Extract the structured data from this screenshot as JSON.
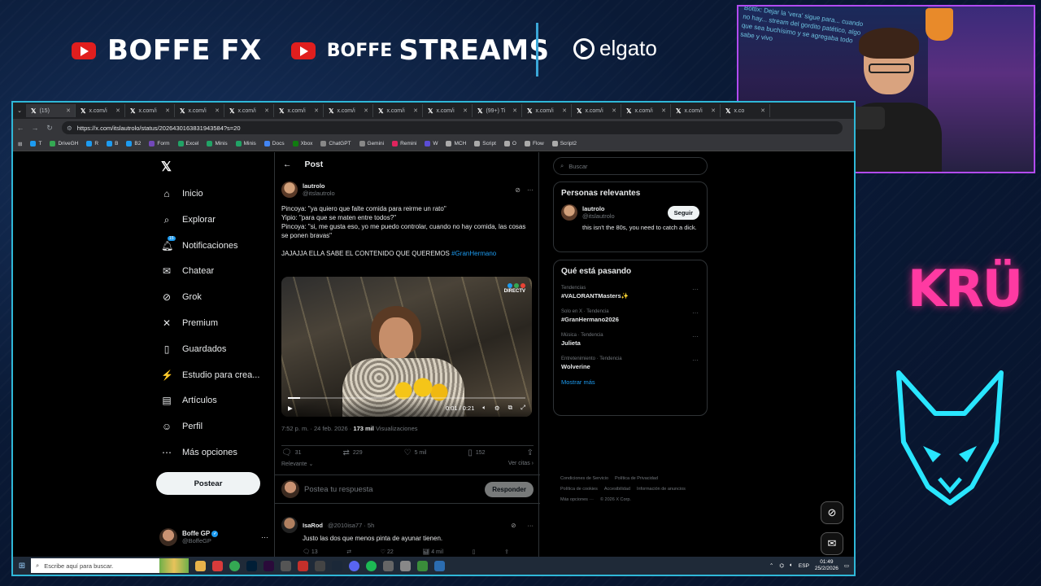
{
  "banner": {
    "brand1": "BOFFE FX",
    "brand2_small": "BOFFE",
    "brand2_big": "STREAMS",
    "sponsor": "elgato"
  },
  "overlay": {
    "kru": "KRÜ",
    "webcam_chat": "Bottix: Dejar la 'vera' sigue para... cuando no hay... stream del gordito patético, algo que sea buchísimo y se agregaba todo sabe y vivo"
  },
  "browser": {
    "tabs": [
      {
        "label": "(15)",
        "active": true
      },
      {
        "label": "x.com/i"
      },
      {
        "label": "x.com/i"
      },
      {
        "label": "x.com/i"
      },
      {
        "label": "x.com/i"
      },
      {
        "label": "x.com/i"
      },
      {
        "label": "x.com/i"
      },
      {
        "label": "x.com/i"
      },
      {
        "label": "x.com/i"
      },
      {
        "label": "(99+) Ti"
      },
      {
        "label": "x.com/i"
      },
      {
        "label": "x.com/i"
      },
      {
        "label": "x.com/i"
      },
      {
        "label": "x.com/i"
      },
      {
        "label": "x.co"
      }
    ],
    "url": "https://x.com/itslautrolo/status/2026430163831943584?s=20",
    "bookmarks": [
      {
        "label": "T",
        "color": "#1d9bf0"
      },
      {
        "label": "DriveGH",
        "color": "#34a853"
      },
      {
        "label": "R",
        "color": "#1d9bf0"
      },
      {
        "label": "B",
        "color": "#1d9bf0"
      },
      {
        "label": "B2",
        "color": "#1d9bf0"
      },
      {
        "label": "Form",
        "color": "#7248b9"
      },
      {
        "label": "Excel",
        "color": "#21a366"
      },
      {
        "label": "Minis",
        "color": "#21a366"
      },
      {
        "label": "Minis",
        "color": "#21a366"
      },
      {
        "label": "Docs",
        "color": "#4285f4"
      },
      {
        "label": "Xbox",
        "color": "#107c10"
      },
      {
        "label": "ChatGPT",
        "color": "#888888"
      },
      {
        "label": "Gemini",
        "color": "#888888"
      },
      {
        "label": "Remini",
        "color": "#e0245e"
      },
      {
        "label": "W",
        "color": "#5b4dd6"
      },
      {
        "label": "MCH",
        "color": "#aaaaaa"
      },
      {
        "label": "Script",
        "color": "#aaaaaa"
      },
      {
        "label": "O",
        "color": "#aaaaaa"
      },
      {
        "label": "Flow",
        "color": "#aaaaaa"
      },
      {
        "label": "Script2",
        "color": "#aaaaaa"
      }
    ]
  },
  "nav": {
    "items": [
      {
        "label": "Inicio",
        "icon": "home-icon",
        "glyph": "⌂"
      },
      {
        "label": "Explorar",
        "icon": "search-icon",
        "glyph": "⌕"
      },
      {
        "label": "Notificaciones",
        "icon": "bell-icon",
        "glyph": "🔔︎",
        "badge": "15"
      },
      {
        "label": "Chatear",
        "icon": "mail-icon",
        "glyph": "✉"
      },
      {
        "label": "Grok",
        "icon": "grok-icon",
        "glyph": "⊘"
      },
      {
        "label": "Premium",
        "icon": "x-premium-icon",
        "glyph": "✕"
      },
      {
        "label": "Guardados",
        "icon": "bookmark-icon",
        "glyph": "▯"
      },
      {
        "label": "Estudio para crea...",
        "icon": "studio-icon",
        "glyph": "⚡"
      },
      {
        "label": "Artículos",
        "icon": "articles-icon",
        "glyph": "▤"
      },
      {
        "label": "Perfil",
        "icon": "profile-icon",
        "glyph": "☺"
      },
      {
        "label": "Más opciones",
        "icon": "more-icon",
        "glyph": "⋯"
      }
    ],
    "post_button": "Postear",
    "account": {
      "name": "Boffe GP",
      "handle": "@BoffeGP"
    }
  },
  "post": {
    "header": "Post",
    "author_name": "lautrolo",
    "author_handle": "@itslautrolo",
    "lines": [
      "Pincoya: \"ya quiero que falte comida para reirme un rato\"",
      "Yipio: \"para que se maten entre todos?\"",
      "Pincoya: \"si, me gusta eso, yo me puedo controlar, cuando no hay comida, las cosas se ponen bravas\""
    ],
    "line_last": "JAJAJJA ELLA SABE EL CONTENIDO QUE QUEREMOS",
    "hashtag": "#GranHermano",
    "video": {
      "logo": "DIRECTV",
      "time": "0:01 / 0:21",
      "progress": 0.05
    },
    "time": "7:52 p. m. · 24 feb. 2026 ·",
    "views": "173 mil",
    "views_label": "Visualizaciones",
    "replies": "31",
    "reposts": "229",
    "likes": "5 mil",
    "bookmarks": "152",
    "sort_label": "Relevante",
    "quotes_label": "Ver citas"
  },
  "reply_box": {
    "placeholder": "Postea tu respuesta",
    "button": "Responder"
  },
  "reply": {
    "name": "IsaRod",
    "handle": "@2010isa77 · 5h",
    "text": "Justo las dos que menos pinta de ayunar  tienen.",
    "replies": "13",
    "likes": "22",
    "views": "4 mil"
  },
  "sidebar": {
    "search_placeholder": "Buscar",
    "relevant_title": "Personas relevantes",
    "relevant": {
      "name": "lautrolo",
      "handle": "@itslautrolo",
      "follow": "Seguir",
      "bio": "this isn't the 80s, you need to catch a dick."
    },
    "trends_title": "Qué está pasando",
    "trends": [
      {
        "cat": "Tendencias",
        "name": "#VALORANTMasters✨"
      },
      {
        "cat": "Solo en X · Tendencia",
        "name": "#GranHermano2026"
      },
      {
        "cat": "Música · Tendencia",
        "name": "Julieta"
      },
      {
        "cat": "Entretenimiento · Tendencia",
        "name": "Wolverine"
      }
    ],
    "show_more": "Mostrar más",
    "footer": [
      "Condiciones de Servicio",
      "Política de Privacidad",
      "Política de cookies",
      "Accesibilidad",
      "Información de anuncios",
      "Más opciones ···",
      "© 2026 X Corp."
    ]
  },
  "taskbar": {
    "search_placeholder": "Escribe aquí para buscar.",
    "lang": "ESP",
    "time": "01:49",
    "date": "25/2/2026"
  }
}
